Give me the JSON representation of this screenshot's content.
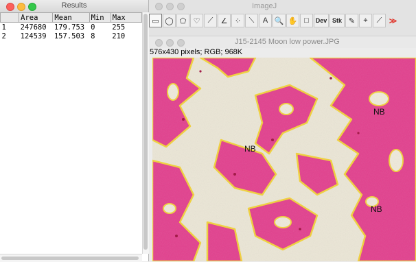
{
  "results_window": {
    "title": "Results",
    "columns": [
      "",
      "Area",
      "Mean",
      "Min",
      "Max"
    ],
    "rows": [
      [
        "1",
        "247680",
        "179.753",
        "0",
        "255"
      ],
      [
        "2",
        "124539",
        "157.503",
        "8",
        "210"
      ]
    ]
  },
  "imagej_window": {
    "title": "ImageJ",
    "tools": [
      {
        "name": "rectangle-tool",
        "glyph": "▭"
      },
      {
        "name": "oval-tool",
        "glyph": "◯"
      },
      {
        "name": "polygon-tool",
        "glyph": "⬠"
      },
      {
        "name": "freehand-tool",
        "glyph": "♡"
      },
      {
        "name": "line-tool",
        "glyph": "⟋"
      },
      {
        "name": "angle-tool",
        "glyph": "∠"
      },
      {
        "name": "point-tool",
        "glyph": "⁘"
      },
      {
        "name": "wand-tool",
        "glyph": "⟍"
      },
      {
        "name": "text-tool",
        "glyph": "A"
      },
      {
        "name": "magnifier-tool",
        "glyph": "🔍"
      },
      {
        "name": "hand-tool",
        "glyph": "✋"
      },
      {
        "name": "color-picker-tool",
        "glyph": "□"
      },
      {
        "name": "developer-menu",
        "glyph": "Dev"
      },
      {
        "name": "stack-menu",
        "glyph": "Stk"
      },
      {
        "name": "brush-tool",
        "glyph": "✎"
      },
      {
        "name": "flood-fill-tool",
        "glyph": "⌖"
      },
      {
        "name": "dropper-tool",
        "glyph": "⟋"
      },
      {
        "name": "more-tools",
        "glyph": "≫"
      }
    ]
  },
  "image_window": {
    "title": "J15-2145 Moon low power.JPG",
    "info": "576x430 pixels; RGB; 968K",
    "labels": [
      "NB",
      "NB",
      "NB"
    ]
  },
  "colors": {
    "tissue_pink": "#e2408e",
    "tissue_yellow": "#f2d23a",
    "background_cream": "#ebe6d6"
  }
}
